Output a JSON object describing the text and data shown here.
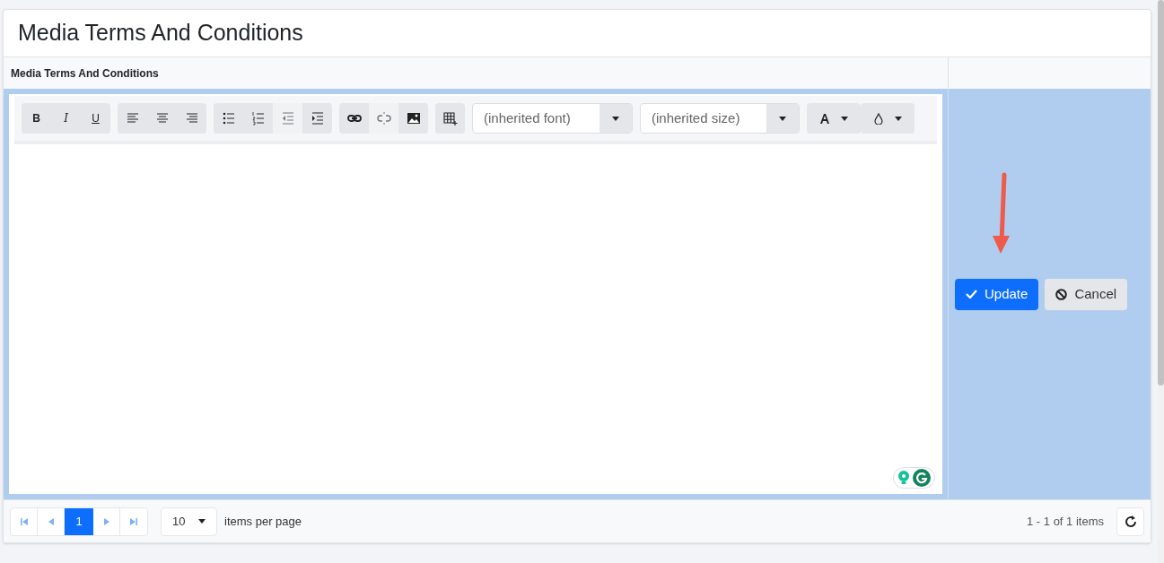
{
  "title": "Media Terms And Conditions",
  "table": {
    "columns": [
      "Media Terms And Conditions"
    ],
    "row": {
      "selected": true,
      "editor": {
        "toolbar": [
          [
            {
              "kind": "bold",
              "label": "B",
              "disabled": false
            },
            {
              "kind": "italic",
              "label": "I",
              "disabled": false
            },
            {
              "kind": "underline",
              "label": "U",
              "disabled": false
            }
          ],
          [
            {
              "kind": "align-left",
              "disabled": false
            },
            {
              "kind": "align-center",
              "disabled": false
            },
            {
              "kind": "align-right",
              "disabled": false
            }
          ],
          [
            {
              "kind": "bullet-list",
              "disabled": false
            },
            {
              "kind": "numbered-list",
              "disabled": false
            },
            {
              "kind": "outdent",
              "disabled": true
            },
            {
              "kind": "indent",
              "disabled": false
            }
          ],
          [
            {
              "kind": "link",
              "disabled": false
            },
            {
              "kind": "unlink",
              "disabled": true
            },
            {
              "kind": "image",
              "disabled": false
            }
          ],
          [
            {
              "kind": "table",
              "disabled": false
            }
          ]
        ],
        "font": {
          "placeholder": "(inherited font)"
        },
        "size": {
          "placeholder": "(inherited size)"
        }
      },
      "actions": [
        {
          "label": "Update",
          "kind": "primary"
        },
        {
          "label": "Cancel",
          "kind": "secondary"
        }
      ]
    }
  },
  "pager": {
    "pages": [
      {
        "label": "1",
        "selected": true
      }
    ],
    "page_size": "10",
    "page_size_label": "items per page",
    "summary": "1 - 1 of 1 items"
  }
}
